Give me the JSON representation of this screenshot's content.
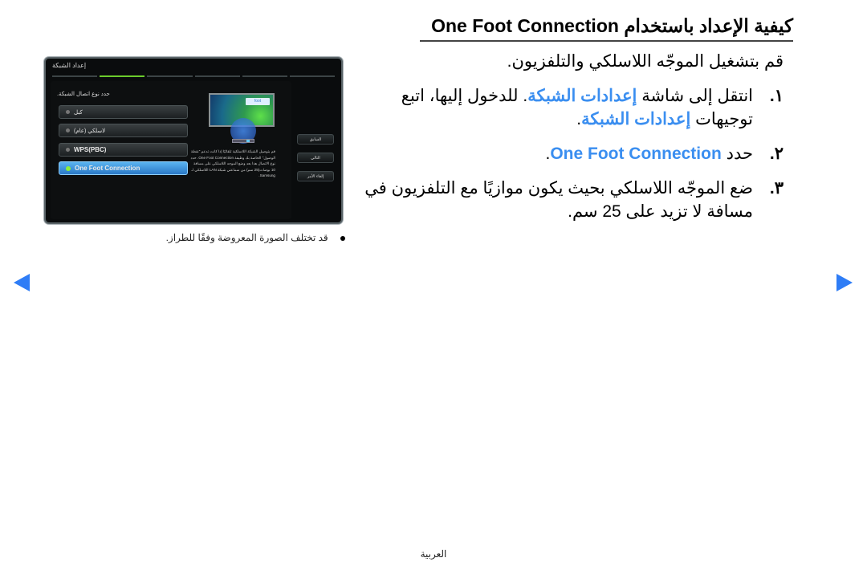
{
  "heading": {
    "arabic": "كيفية الإعداد باستخدام",
    "latin": "One Foot Connection"
  },
  "intro": "قم بتشغيل الموجّه اللاسلكي والتلفزيون.",
  "steps": [
    {
      "number": "١.",
      "text_before": "انتقل إلى شاشة",
      "highlight1": "إعدادات الشبكة",
      "text_middle": ". للدخول إليها، اتبع توجيهات",
      "highlight2": "إعدادات الشبكة",
      "text_after": "."
    },
    {
      "number": "٢.",
      "text_before": "حدد",
      "highlight": "One Foot Connection",
      "text_after": "."
    },
    {
      "number": "٣.",
      "text": "ضع الموجّه اللاسلكي بحيث يكون موازيًا مع التلفزيون في مسافة لا تزيد على 25 سم."
    }
  ],
  "tv_screen": {
    "title": "إعداد الشبكة",
    "progress": {
      "total_steps": 6,
      "current_step": 2
    },
    "prompt": "حدد نوع اتصال الشبكة.",
    "options": [
      {
        "label": "كبل",
        "selected": false
      },
      {
        "label": "لاسلكي (عام)",
        "selected": false
      },
      {
        "label": "WPS(PBC)",
        "selected": false
      },
      {
        "label": "One Foot Connection",
        "selected": true
      }
    ],
    "screen_logo": "foot",
    "description": "قم بتوصيل الشبكة اللاسلكية تلقائيًا إذا كانت تدعم \"نقطة الوصول\" الخاصة بك وظيفة One Foot Connection. حدد نوع الاتصال هذا بعد وضع الموجه اللاسلكي على مسافة 10 بوصات(25 سم) من سماعتي شبكة LAN اللاسلكي لـ Samsung.",
    "buttons": [
      {
        "label": "السابق"
      },
      {
        "label": "التالي"
      },
      {
        "label": "إلغاء الأمر"
      }
    ]
  },
  "note": "قد تختلف الصورة المعروضة وفقًا للطراز.",
  "navigation": {
    "prev_icon": "triangle-left",
    "next_icon": "triangle-right",
    "accent_color": "#2f7df6"
  },
  "footer": {
    "language": "العربية"
  },
  "colors": {
    "highlight_text": "#3a8ef0",
    "selected_option": "#2a78c6",
    "progress_active": "#6ccc2c"
  }
}
